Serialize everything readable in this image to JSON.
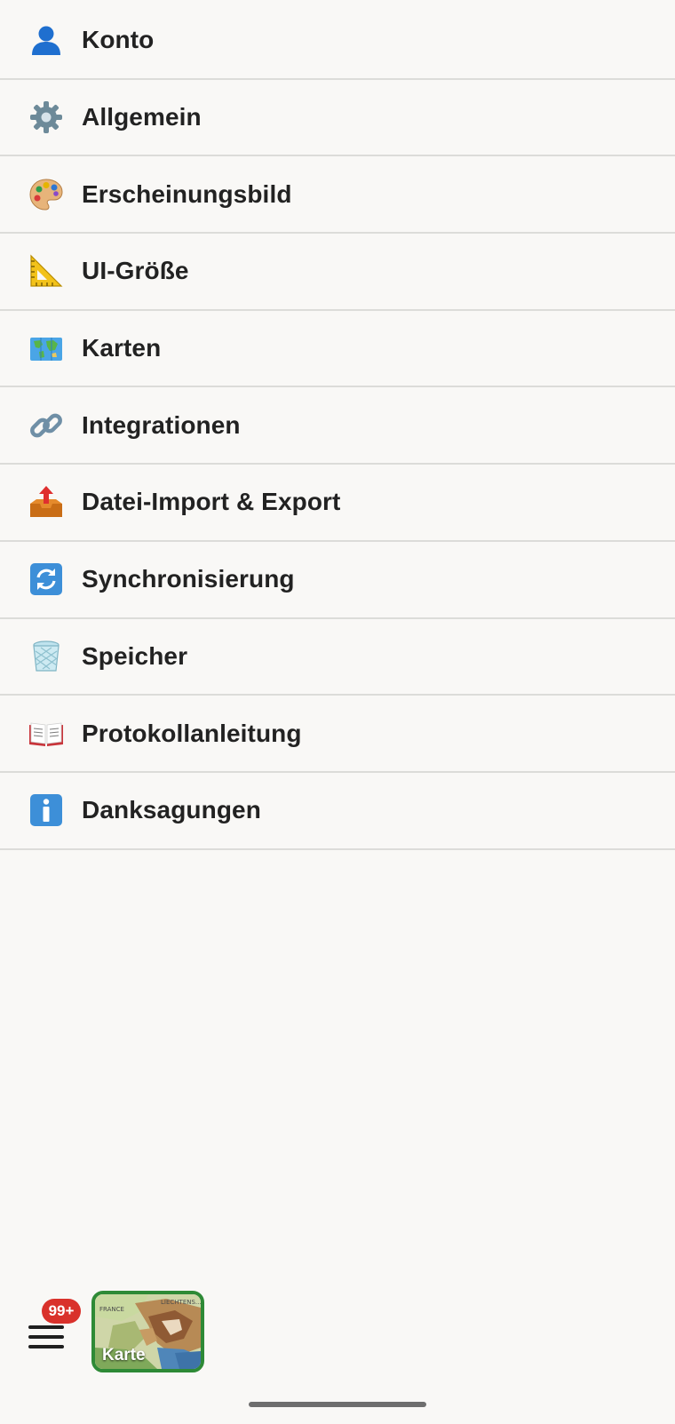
{
  "menu": {
    "items": [
      {
        "id": "konto",
        "label": "Konto",
        "icon": "person-icon"
      },
      {
        "id": "allgemein",
        "label": "Allgemein",
        "icon": "gear-icon"
      },
      {
        "id": "erscheinungsbild",
        "label": "Erscheinungsbild",
        "icon": "palette-icon"
      },
      {
        "id": "ui-groesse",
        "label": "UI-Größe",
        "icon": "triangle-ruler-icon"
      },
      {
        "id": "karten",
        "label": "Karten",
        "icon": "world-map-icon"
      },
      {
        "id": "integrationen",
        "label": "Integrationen",
        "icon": "link-icon"
      },
      {
        "id": "datei-import-export",
        "label": "Datei-Import & Export",
        "icon": "outbox-tray-icon"
      },
      {
        "id": "synchronisierung",
        "label": "Synchronisierung",
        "icon": "sync-arrows-icon"
      },
      {
        "id": "speicher",
        "label": "Speicher",
        "icon": "wastebasket-icon"
      },
      {
        "id": "protokollanleitung",
        "label": "Protokollanleitung",
        "icon": "open-book-icon"
      },
      {
        "id": "danksagungen",
        "label": "Danksagungen",
        "icon": "info-icon"
      }
    ]
  },
  "bottom_bar": {
    "menu_icon": "hamburger-menu-icon",
    "badge_count": "99+",
    "map_tile_label": "Karte",
    "map_region_labels": [
      "FRANCE",
      "LIECHTENS..."
    ]
  },
  "colors": {
    "background": "#f9f8f6",
    "divider": "#dcdcd9",
    "badge": "#d9312b",
    "map_tile_border": "#2e8a36"
  }
}
